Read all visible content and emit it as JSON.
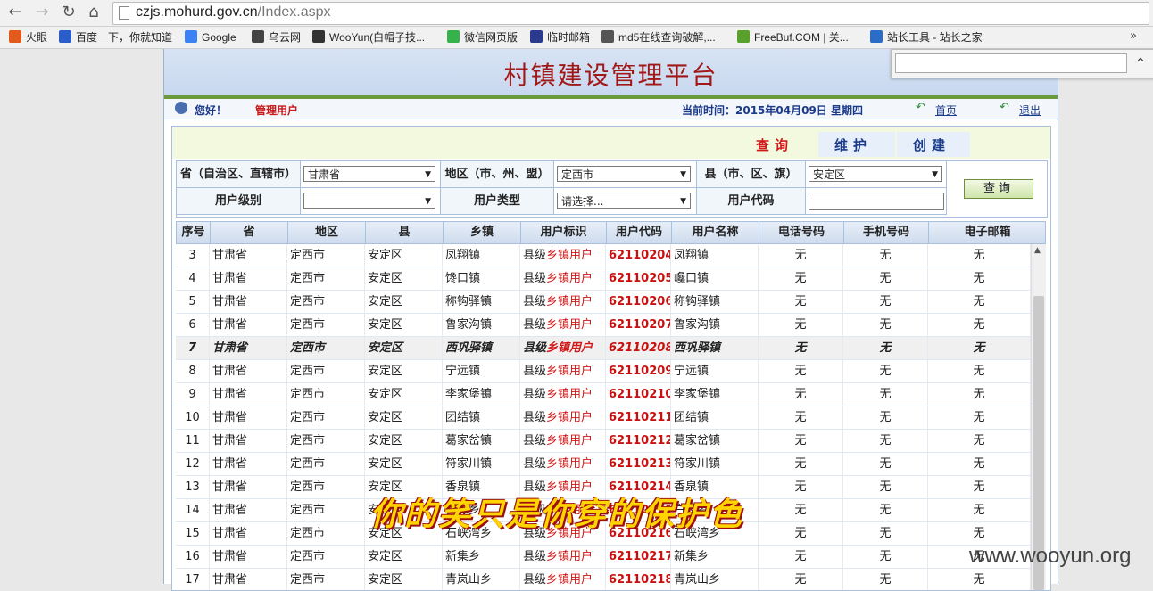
{
  "browser": {
    "url_host": "czjs.mohurd.gov.cn",
    "url_path": "/Index.aspx",
    "bookmarks": [
      {
        "label": "火眼",
        "color": "#e25a1c"
      },
      {
        "label": "百度一下，你就知道",
        "color": "#2b5dc8"
      },
      {
        "label": "Google",
        "color": "#3b82f6"
      },
      {
        "label": "乌云网",
        "color": "#444444"
      },
      {
        "label": "WooYun(白帽子技...",
        "color": "#333333"
      },
      {
        "label": "微信网页版",
        "color": "#36b24a"
      },
      {
        "label": "临时邮箱",
        "color": "#2a3b8f"
      },
      {
        "label": "md5在线查询破解,...",
        "color": "#555555"
      },
      {
        "label": "FreeBuf.COM | 关...",
        "color": "#5aa02c"
      },
      {
        "label": "站长工具 - 站长之家",
        "color": "#2b6cc8"
      }
    ],
    "more": "»"
  },
  "header": {
    "title": "村镇建设管理平台",
    "greeting": "您好！",
    "role": "管理用户",
    "time_label": "当前时间：2015年04月09日 星期四",
    "home": "首页",
    "logout": "退出"
  },
  "tabs": {
    "query": "查询",
    "maintain": "维护",
    "create": "创建"
  },
  "form": {
    "province_label": "省（自治区、直辖市）",
    "province_value": "甘肃省",
    "region_label": "地区（市、州、盟）",
    "region_value": "定西市",
    "county_label": "县（市、区、旗）",
    "county_value": "安定区",
    "level_label": "用户级别",
    "level_value": "",
    "type_label": "用户类型",
    "type_value": "请选择...",
    "code_label": "用户代码",
    "code_value": "",
    "query_button": "查询"
  },
  "table": {
    "columns": [
      "序号",
      "省",
      "地区",
      "县",
      "乡镇",
      "用户标识",
      "用户代码",
      "用户名称",
      "电话号码",
      "手机号码",
      "电子邮箱"
    ],
    "rows": [
      {
        "no": "3",
        "prov": "甘肃省",
        "reg": "定西市",
        "cty": "安定区",
        "town": "凤翔镇",
        "id_a": "县级",
        "id_b": "乡镇用户",
        "code": "62110204",
        "name": "凤翔镇",
        "tel": "无",
        "mob": "无",
        "mail": "无"
      },
      {
        "no": "4",
        "prov": "甘肃省",
        "reg": "定西市",
        "cty": "安定区",
        "town": "馋口镇",
        "id_a": "县级",
        "id_b": "乡镇用户",
        "code": "62110205",
        "name": "巉口镇",
        "tel": "无",
        "mob": "无",
        "mail": "无"
      },
      {
        "no": "5",
        "prov": "甘肃省",
        "reg": "定西市",
        "cty": "安定区",
        "town": "称钩驿镇",
        "id_a": "县级",
        "id_b": "乡镇用户",
        "code": "62110206",
        "name": "称钩驿镇",
        "tel": "无",
        "mob": "无",
        "mail": "无"
      },
      {
        "no": "6",
        "prov": "甘肃省",
        "reg": "定西市",
        "cty": "安定区",
        "town": "鲁家沟镇",
        "id_a": "县级",
        "id_b": "乡镇用户",
        "code": "62110207",
        "name": "鲁家沟镇",
        "tel": "无",
        "mob": "无",
        "mail": "无"
      },
      {
        "no": "7",
        "prov": "甘肃省",
        "reg": "定西市",
        "cty": "安定区",
        "town": "西巩驿镇",
        "id_a": "县级",
        "id_b": "乡镇用户",
        "code": "62110208",
        "name": "西巩驿镇",
        "tel": "无",
        "mob": "无",
        "mail": "无"
      },
      {
        "no": "8",
        "prov": "甘肃省",
        "reg": "定西市",
        "cty": "安定区",
        "town": "宁远镇",
        "id_a": "县级",
        "id_b": "乡镇用户",
        "code": "62110209",
        "name": "宁远镇",
        "tel": "无",
        "mob": "无",
        "mail": "无"
      },
      {
        "no": "9",
        "prov": "甘肃省",
        "reg": "定西市",
        "cty": "安定区",
        "town": "李家堡镇",
        "id_a": "县级",
        "id_b": "乡镇用户",
        "code": "62110210",
        "name": "李家堡镇",
        "tel": "无",
        "mob": "无",
        "mail": "无"
      },
      {
        "no": "10",
        "prov": "甘肃省",
        "reg": "定西市",
        "cty": "安定区",
        "town": "团结镇",
        "id_a": "县级",
        "id_b": "乡镇用户",
        "code": "62110211",
        "name": "团结镇",
        "tel": "无",
        "mob": "无",
        "mail": "无"
      },
      {
        "no": "11",
        "prov": "甘肃省",
        "reg": "定西市",
        "cty": "安定区",
        "town": "葛家岔镇",
        "id_a": "县级",
        "id_b": "乡镇用户",
        "code": "62110212",
        "name": "葛家岔镇",
        "tel": "无",
        "mob": "无",
        "mail": "无"
      },
      {
        "no": "12",
        "prov": "甘肃省",
        "reg": "定西市",
        "cty": "安定区",
        "town": "符家川镇",
        "id_a": "县级",
        "id_b": "乡镇用户",
        "code": "62110213",
        "name": "符家川镇",
        "tel": "无",
        "mob": "无",
        "mail": "无"
      },
      {
        "no": "13",
        "prov": "甘肃省",
        "reg": "定西市",
        "cty": "安定区",
        "town": "香泉镇",
        "id_a": "县级",
        "id_b": "乡镇用户",
        "code": "62110214",
        "name": "香泉镇",
        "tel": "无",
        "mob": "无",
        "mail": "无"
      },
      {
        "no": "14",
        "prov": "甘肃省",
        "reg": "定西市",
        "cty": "安定区",
        "town": "白碌乡",
        "id_a": "县级",
        "id_b": "乡镇用户",
        "code": "62110215",
        "name": "白碌乡",
        "tel": "无",
        "mob": "无",
        "mail": "无"
      },
      {
        "no": "15",
        "prov": "甘肃省",
        "reg": "定西市",
        "cty": "安定区",
        "town": "石峡湾乡",
        "id_a": "县级",
        "id_b": "乡镇用户",
        "code": "62110216",
        "name": "石峡湾乡",
        "tel": "无",
        "mob": "无",
        "mail": "无"
      },
      {
        "no": "16",
        "prov": "甘肃省",
        "reg": "定西市",
        "cty": "安定区",
        "town": "新集乡",
        "id_a": "县级",
        "id_b": "乡镇用户",
        "code": "62110217",
        "name": "新集乡",
        "tel": "无",
        "mob": "无",
        "mail": "无"
      },
      {
        "no": "17",
        "prov": "甘肃省",
        "reg": "定西市",
        "cty": "安定区",
        "town": "青岚山乡",
        "id_a": "县级",
        "id_b": "乡镇用户",
        "code": "62110218",
        "name": "青岚山乡",
        "tel": "无",
        "mob": "无",
        "mail": "无"
      }
    ]
  },
  "overlay_text": "你的笑只是你穿的保护色",
  "watermark": "www.wooyun.org"
}
